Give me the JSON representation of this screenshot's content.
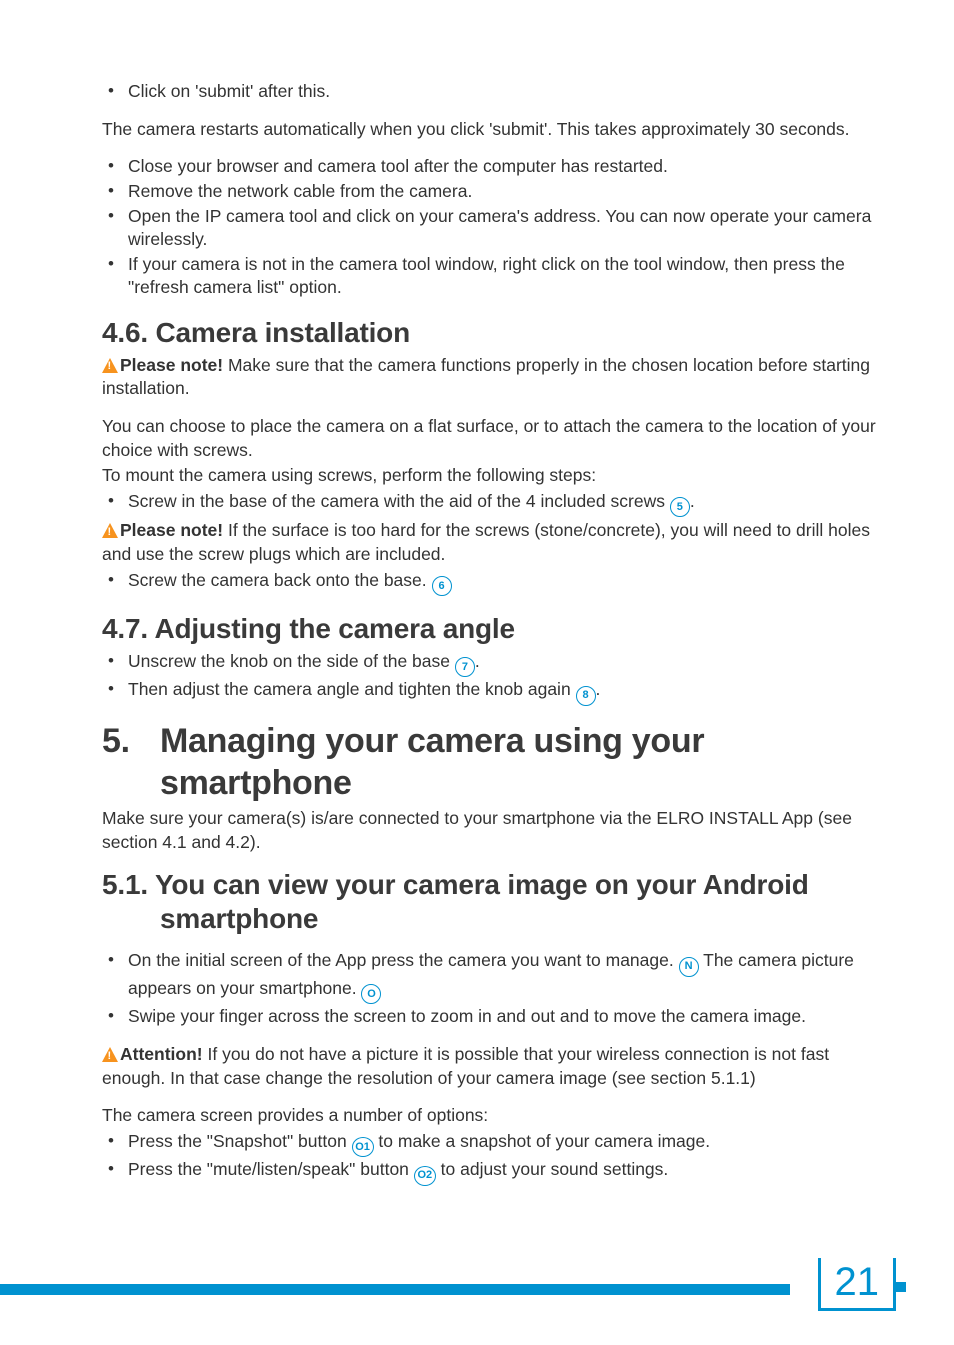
{
  "top_list": {
    "item1": "Click on 'submit' after this."
  },
  "para1": "The camera restarts automatically when you click 'submit'. This takes approximately 30 seconds.",
  "list2": {
    "i1": "Close your browser and camera tool after the computer has restarted.",
    "i2": "Remove the network cable from the camera.",
    "i3": "Open the IP camera tool and click on your camera's address. You can now operate your camera wirelessly.",
    "i4": "If your camera is not in the camera tool window, right click on the tool window, then press the \"refresh camera list\" option."
  },
  "sec46": {
    "title": "4.6.  Camera installation",
    "note_label": "Please note!",
    "note_text": " Make sure that the camera functions properly in the chosen location before starting installation.",
    "p1": "You can choose to place the camera on a flat surface, or to attach the camera to the location of your choice with screws.",
    "p2": "To mount the camera using screws, perform the following steps:",
    "li1a": "Screw in the base of the camera with the aid of the 4 included screws ",
    "li1b": ".",
    "note2_label": "Please note!",
    "note2_text": " If the surface is too hard for the screws (stone/concrete), you will need to drill holes and use the screw plugs which are included.",
    "li2a": "Screw the camera back onto the base. "
  },
  "sec47": {
    "title": "4.7.  Adjusting the camera angle",
    "li1a": "Unscrew the knob on the side of the base ",
    "li1b": ".",
    "li2a": "Then adjust the camera angle and tighten the knob again ",
    "li2b": "."
  },
  "chap5": {
    "num": "5.",
    "line1": "Managing your camera using your",
    "line2": "smartphone",
    "p": "Make sure your camera(s) is/are connected to your smartphone via the ELRO INSTALL App (see section 4.1 and 4.2)."
  },
  "sec51": {
    "title_l1": "5.1.  You can view your camera image on your Android",
    "title_l2": "smartphone",
    "li1a": "On the initial screen of the App press the camera you want to manage. ",
    "li1b": " The camera picture appears on your smartphone. ",
    "li2": "Swipe your finger across the screen to zoom in and out and to move the camera image.",
    "attn_label": "Attention!",
    "attn_text": " If you do not have a picture it is possible that your wireless connection is not fast enough. In that case change the resolution of your camera image (see section 5.1.1)",
    "p3": "The camera screen provides a number of options:",
    "li3a": "Press the \"Snapshot\" button ",
    "li3b": " to make a snapshot of your camera image.",
    "li4a": "Press the \"mute/listen/speak\" button ",
    "li4b": " to adjust your sound settings."
  },
  "refs": {
    "r5": "5",
    "r6": "6",
    "r7": "7",
    "r8": "8",
    "rN": "N",
    "rO": "O",
    "rO1": "O1",
    "rO2": "O2"
  },
  "page": "21"
}
